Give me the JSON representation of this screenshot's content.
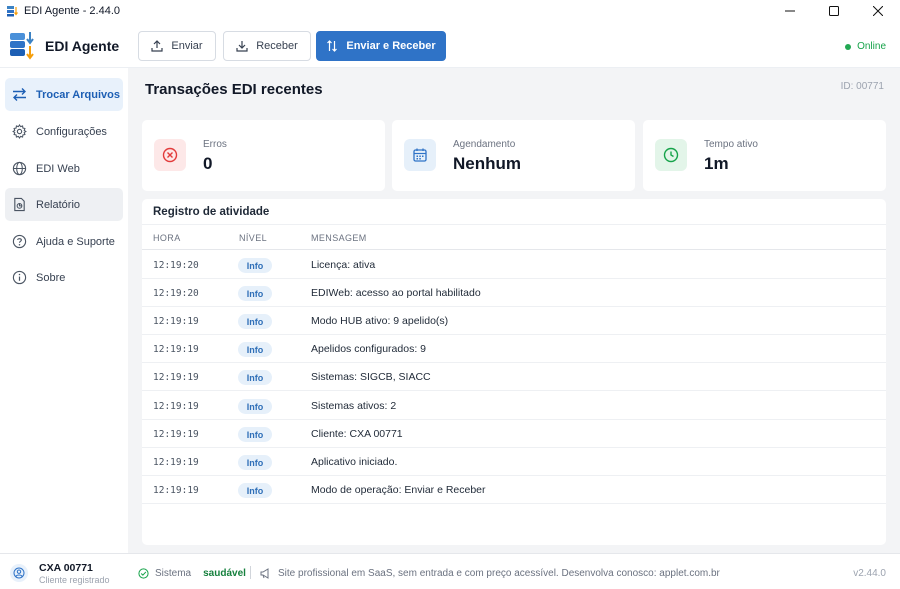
{
  "window": {
    "title": "EDI Agente - 2.44.0"
  },
  "header": {
    "brand": "EDI Agente",
    "buttons": {
      "send": "Enviar",
      "receive": "Receber",
      "send_receive": "Enviar e Receber"
    },
    "status": "Online"
  },
  "sidebar": {
    "items": [
      {
        "label": "Trocar Arquivos",
        "icon": "swap-arrows-icon"
      },
      {
        "label": "Configurações",
        "icon": "gear-icon"
      },
      {
        "label": "EDI Web",
        "icon": "globe-icon"
      },
      {
        "label": "Relatório",
        "icon": "report-icon"
      },
      {
        "label": "Ajuda e Suporte",
        "icon": "help-icon"
      },
      {
        "label": "Sobre",
        "icon": "info-icon"
      }
    ]
  },
  "main": {
    "title": "Transações EDI recentes",
    "id": "ID: 00771",
    "cards": [
      {
        "label": "Erros",
        "value": "0",
        "icon": "error-x-icon"
      },
      {
        "label": "Agendamento",
        "value": "Nenhum",
        "icon": "calendar-icon"
      },
      {
        "label": "Tempo ativo",
        "value": "1m",
        "icon": "clock-icon"
      }
    ],
    "log": {
      "title": "Registro de atividade",
      "columns": [
        "HORA",
        "NÍVEL",
        "MENSAGEM"
      ],
      "rows": [
        {
          "time": "12:19:20",
          "level": "Info",
          "message": "Licença: ativa"
        },
        {
          "time": "12:19:20",
          "level": "Info",
          "message": "EDIWeb: acesso ao portal habilitado"
        },
        {
          "time": "12:19:19",
          "level": "Info",
          "message": "Modo HUB ativo: 9 apelido(s)"
        },
        {
          "time": "12:19:19",
          "level": "Info",
          "message": "Apelidos configurados: 9"
        },
        {
          "time": "12:19:19",
          "level": "Info",
          "message": "Sistemas: SIGCB, SIACC"
        },
        {
          "time": "12:19:19",
          "level": "Info",
          "message": "Sistemas ativos: 2"
        },
        {
          "time": "12:19:19",
          "level": "Info",
          "message": "Cliente: CXA 00771"
        },
        {
          "time": "12:19:19",
          "level": "Info",
          "message": "Aplicativo iniciado."
        },
        {
          "time": "12:19:19",
          "level": "Info",
          "message": "Modo de operação: Enviar e Receber"
        }
      ]
    }
  },
  "footer": {
    "user_name": "CXA 00771",
    "user_sub": "Cliente registrado",
    "system_label": "Sistema",
    "system_status": "saudável",
    "promo": "Site profissional em SaaS, sem entrada e com preço acessível. Desenvolva conosco: applet.com.br",
    "version": "v2.44.0"
  },
  "colors": {
    "accent": "#2f73c7",
    "online": "#22a853",
    "error": "#e23b3b",
    "success": "#16a34a"
  }
}
